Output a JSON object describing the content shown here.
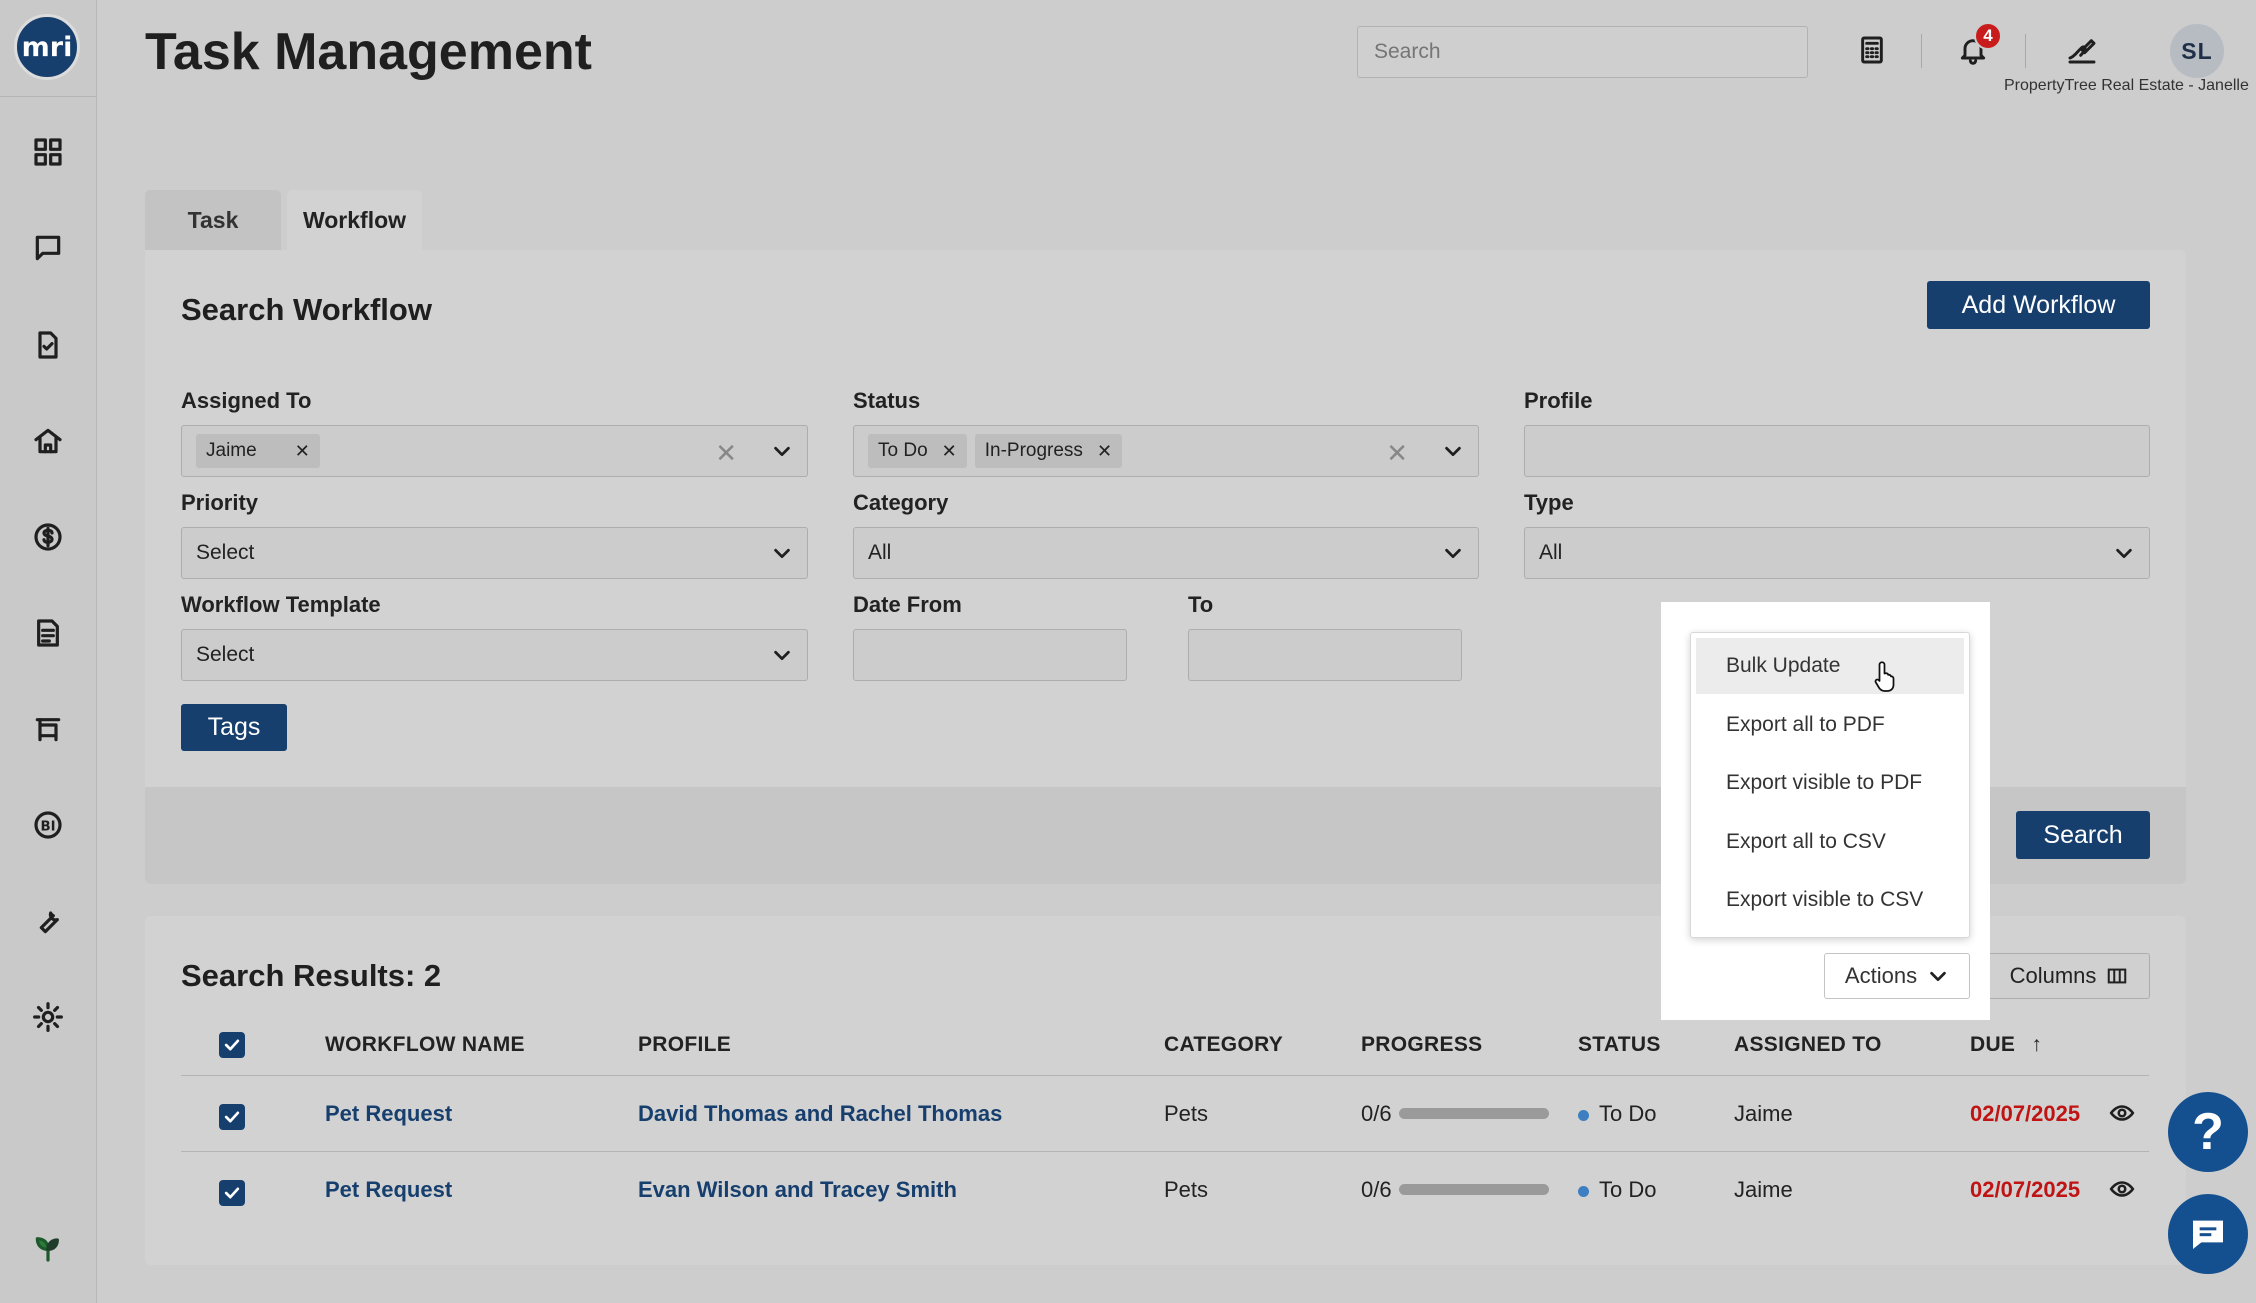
{
  "app": {
    "logo_text": "mri",
    "page_title": "Task Management",
    "company": "PropertyTree Real Estate - Janelle",
    "avatar_initials": "SL",
    "notifications_count": "4",
    "search_placeholder": "Search"
  },
  "sidebar": {
    "items": [
      {
        "icon": "dashboard-grid-icon"
      },
      {
        "icon": "chat-bubble-icon"
      },
      {
        "icon": "task-document-icon"
      },
      {
        "icon": "home-icon"
      },
      {
        "icon": "dollar-icon"
      },
      {
        "icon": "report-icon"
      },
      {
        "icon": "maintenance-icon"
      },
      {
        "icon": "bi-icon"
      },
      {
        "icon": "wrench-icon"
      },
      {
        "icon": "settings-gear-icon"
      },
      {
        "icon": "leaf-icon"
      }
    ]
  },
  "tabs": [
    {
      "label": "Task"
    },
    {
      "label": "Workflow",
      "active": true
    }
  ],
  "search_panel": {
    "title": "Search Workflow",
    "add_button": "Add Workflow",
    "search_button": "Search",
    "tags_button": "Tags",
    "fields": {
      "assigned_to": {
        "label": "Assigned To",
        "chips": [
          "Jaime"
        ]
      },
      "status": {
        "label": "Status",
        "chips": [
          "To Do",
          "In-Progress"
        ]
      },
      "profile": {
        "label": "Profile",
        "value": ""
      },
      "priority": {
        "label": "Priority",
        "value": "Select"
      },
      "category": {
        "label": "Category",
        "value": "All"
      },
      "type": {
        "label": "Type",
        "value": "All"
      },
      "workflow_template": {
        "label": "Workflow Template",
        "value": "Select"
      },
      "date_from": {
        "label": "Date From",
        "value": ""
      },
      "date_to": {
        "label": "To",
        "value": ""
      }
    }
  },
  "results": {
    "title": "Search Results: 2",
    "actions_label": "Actions",
    "columns_label": "Columns",
    "headers": [
      "WORKFLOW NAME",
      "PROFILE",
      "CATEGORY",
      "PROGRESS",
      "STATUS",
      "ASSIGNED TO",
      "DUE"
    ],
    "rows": [
      {
        "name": "Pet Request",
        "profile": "David Thomas and Rachel Thomas",
        "category": "Pets",
        "progress": "0/6",
        "progress_fraction": 0,
        "status": "To Do",
        "assigned_to": "Jaime",
        "due": "02/07/2025"
      },
      {
        "name": "Pet Request",
        "profile": "Evan Wilson and Tracey Smith",
        "category": "Pets",
        "progress": "0/6",
        "progress_fraction": 0,
        "status": "To Do",
        "assigned_to": "Jaime",
        "due": "02/07/2025"
      }
    ]
  },
  "actions_menu": {
    "items": [
      "Bulk Update",
      "Export all to PDF",
      "Export visible to PDF",
      "Export all to CSV",
      "Export visible to CSV"
    ],
    "hovered": "Bulk Update"
  },
  "colors": {
    "primary": "#173f6e",
    "due": "#c01414",
    "badge": "#c81c1c",
    "fab": "#14508f"
  }
}
